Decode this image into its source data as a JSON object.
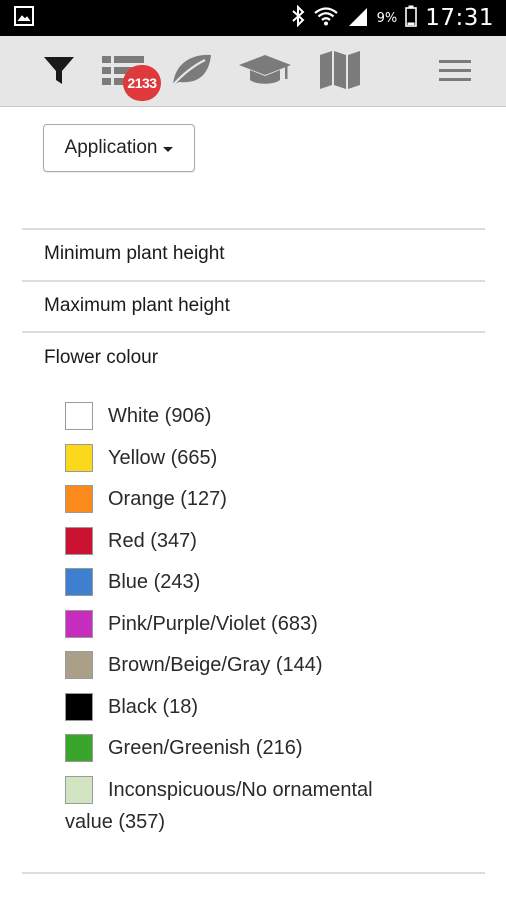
{
  "status_bar": {
    "battery_percent": "9%",
    "time": "17:31",
    "icons": [
      "gallery-icon",
      "bluetooth-icon",
      "wifi-icon",
      "signal-icon",
      "battery-icon"
    ]
  },
  "toolbar": {
    "icons": [
      "filter-icon",
      "list-icon",
      "leaf-icon",
      "graduation-cap-icon",
      "map-icon",
      "menu-icon"
    ],
    "badge_count": "2133",
    "accent_color": "#e0393b"
  },
  "application_dropdown": {
    "label": "Application"
  },
  "sections": {
    "min_height": "Minimum plant height",
    "max_height": "Maximum plant height",
    "flower_colour": "Flower colour"
  },
  "colours": [
    {
      "label": "White (906)",
      "color": "#ffffff"
    },
    {
      "label": "Yellow (665)",
      "color": "#fcd81c"
    },
    {
      "label": "Orange (127)",
      "color": "#fb8a1c"
    },
    {
      "label": "Red (347)",
      "color": "#cc1233"
    },
    {
      "label": "Blue (243)",
      "color": "#3e7fcf"
    },
    {
      "label": "Pink/Purple/Violet (683)",
      "color": "#c82ebd"
    },
    {
      "label": "Brown/Beige/Gray (144)",
      "color": "#aaa08a"
    },
    {
      "label": "Black (18)",
      "color": "#000000"
    },
    {
      "label": "Green/Greenish (216)",
      "color": "#3aa52b"
    },
    {
      "label_line1": "Inconspicuous/No ornamental",
      "label_line2": "value (357)",
      "color": "#d3e4c2"
    }
  ]
}
